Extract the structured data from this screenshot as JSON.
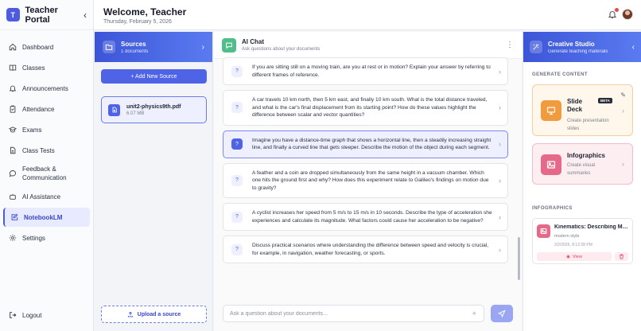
{
  "brand": {
    "logo_letter": "T",
    "title": "Teacher Portal",
    "collapse": "‹"
  },
  "nav": {
    "items": [
      {
        "label": "Dashboard",
        "icon": "home-icon"
      },
      {
        "label": "Classes",
        "icon": "book-icon"
      },
      {
        "label": "Announcements",
        "icon": "bell-icon"
      },
      {
        "label": "Attendance",
        "icon": "clipboard-icon"
      },
      {
        "label": "Exams",
        "icon": "graduation-cap-icon"
      },
      {
        "label": "Class Tests",
        "icon": "document-icon"
      },
      {
        "label": "Feedback & Communication",
        "icon": "chat-icon"
      },
      {
        "label": "AI Assistance",
        "icon": "robot-icon"
      },
      {
        "label": "NotebookLM",
        "icon": "notebook-edit-icon",
        "active": true
      },
      {
        "label": "Settings",
        "icon": "gear-icon"
      }
    ],
    "logout": "Logout"
  },
  "header": {
    "welcome": "Welcome, Teacher",
    "date": "Thursday, February 5, 2026"
  },
  "sources": {
    "title": "Sources",
    "subtitle": "1 documents",
    "add_button": "+ Add New Source",
    "files": [
      {
        "name": "unit2-physics9th.pdf",
        "size": "6.07 MB"
      }
    ],
    "upload_button": "Upload a source"
  },
  "chat": {
    "title": "AI Chat",
    "subtitle": "Ask questions about your documents",
    "questions": [
      "If you are sitting still on a moving train, are you at rest or in motion? Explain your answer by referring to different frames of reference.",
      "A car travels 10 km north, then 5 km east, and finally 10 km south. What is the total distance traveled, and what is the car's final displacement from its starting point? How do these values highlight the difference between scalar and vector quantities?",
      "Imagine you have a distance-time graph that shows a horizontal line, then a steadily increasing straight line, and finally a curved line that gets steeper. Describe the motion of the object during each segment.",
      "A feather and a coin are dropped simultaneously from the same height in a vacuum chamber. Which one hits the ground first and why? How does this experiment relate to Galileo's findings on motion due to gravity?",
      "A cyclist increases her speed from 5 m/s to 15 m/s in 10 seconds. Describe the type of acceleration she experiences and calculate its magnitude. What factors could cause her acceleration to be negative?",
      "Discuss practical scenarios where understanding the difference between speed and velocity is crucial, for example, in navigation, weather forecasting, or sports."
    ],
    "selected_index": 2,
    "input_placeholder": "Ask a question about your documents..."
  },
  "studio": {
    "title": "Creative Studio",
    "subtitle": "Generate teaching materials",
    "generate_label": "GENERATE CONTENT",
    "slide": {
      "title_line1": "Slide",
      "title_line2": "Deck",
      "badge": "BETA",
      "desc_line1": "Create presentation",
      "desc_line2": "slides"
    },
    "info": {
      "title": "Infographics",
      "desc_line1": "Create visual",
      "desc_line2": "summaries"
    },
    "infographics_label": "INFOGRAPHICS",
    "infographic_item": {
      "title": "Kinematics: Describing Motio...",
      "style": "modern style",
      "date": "2/2/2026, 8:12:28 PM",
      "view": "View"
    }
  },
  "colors": {
    "accent": "#4f63e6",
    "slide_orange": "#f19a3e",
    "info_pink": "#e56a8a",
    "chat_green": "#4fbe8a"
  }
}
